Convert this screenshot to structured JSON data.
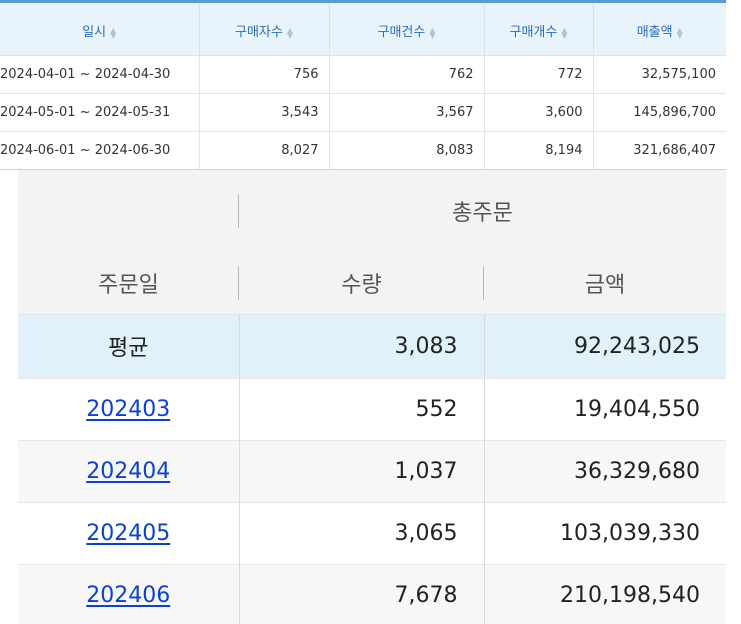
{
  "top_table": {
    "headers": [
      "일시",
      "구매자수",
      "구매건수",
      "구매개수",
      "매출액"
    ],
    "rows": [
      [
        "2024-04-01 ~ 2024-04-30",
        "756",
        "762",
        "772",
        "32,575,100"
      ],
      [
        "2024-05-01 ~ 2024-05-31",
        "3,543",
        "3,567",
        "3,600",
        "145,896,700"
      ],
      [
        "2024-06-01 ~ 2024-06-30",
        "8,027",
        "8,083",
        "8,194",
        "321,686,407"
      ]
    ]
  },
  "summary_table": {
    "group_header": "총주문",
    "headers": [
      "주문일",
      "수량",
      "금액"
    ],
    "average": {
      "label": "평균",
      "qty": "3,083",
      "amount": "92,243,025"
    },
    "rows": [
      {
        "date": "202403",
        "qty": "552",
        "amount": "19,404,550"
      },
      {
        "date": "202404",
        "qty": "1,037",
        "amount": "36,329,680"
      },
      {
        "date": "202405",
        "qty": "3,065",
        "amount": "103,039,330"
      },
      {
        "date": "202406",
        "qty": "7,678",
        "amount": "210,198,540"
      }
    ]
  },
  "colors": {
    "header_accent": "#5b9bd5",
    "link": "#0b3fd6",
    "average_row_bg": "#e1f1fb"
  }
}
